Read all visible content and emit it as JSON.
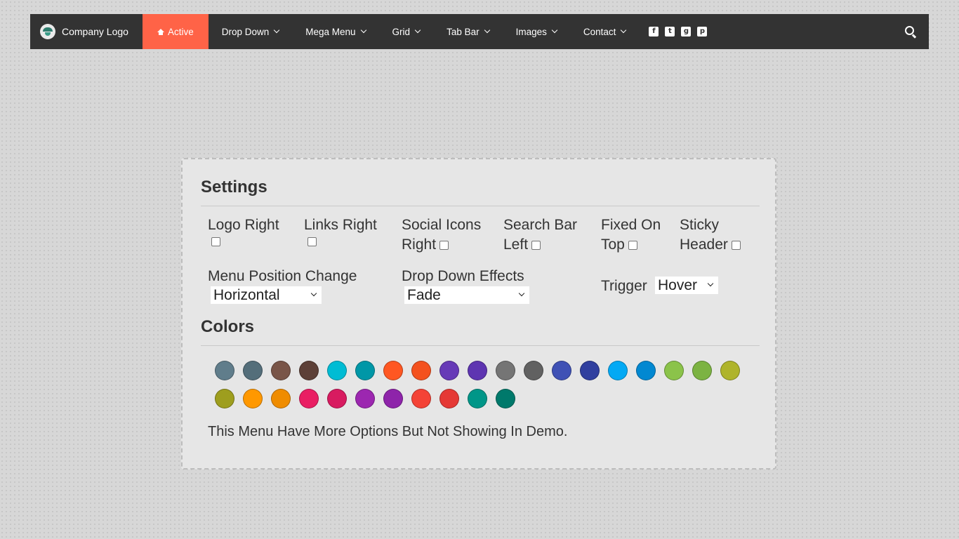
{
  "nav": {
    "brand": "Company Logo",
    "active": "Active",
    "items": [
      "Drop Down",
      "Mega Menu",
      "Grid",
      "Tab Bar",
      "Images",
      "Contact"
    ],
    "social": [
      {
        "name": "facebook-icon",
        "glyph": "f"
      },
      {
        "name": "twitter-icon",
        "glyph": "t"
      },
      {
        "name": "google-plus-icon",
        "glyph": "g"
      },
      {
        "name": "pinterest-icon",
        "glyph": "p"
      }
    ]
  },
  "settings": {
    "title": "Settings",
    "options": {
      "logo_right": "Logo Right",
      "links_right": "Links Right",
      "social_right_1": "Social Icons",
      "social_right_2": "Right",
      "search_left_1": "Search Bar",
      "search_left_2": "Left",
      "fixed_top_1": "Fixed On",
      "fixed_top_2": "Top",
      "sticky_1": "Sticky",
      "sticky_2": "Header"
    },
    "menu_position": {
      "label": "Menu Position Change",
      "value": "Horizontal"
    },
    "drop_effects": {
      "label": "Drop Down Effects",
      "value": "Fade"
    },
    "trigger": {
      "label": "Trigger",
      "value": "Hover"
    }
  },
  "colors": {
    "title": "Colors",
    "swatches": [
      "#607d8b",
      "#546e7a",
      "#795548",
      "#5d4037",
      "#00bcd4",
      "#0097a7",
      "#ff5722",
      "#f4511e",
      "#673ab7",
      "#5e35b1",
      "#757575",
      "#616161",
      "#3f51b5",
      "#303f9f",
      "#03a9f4",
      "#0288d1",
      "#8bc34a",
      "#7cb342",
      "#afb42b",
      "#9e9e1e",
      "#ff9800",
      "#ef8c00",
      "#e91e63",
      "#d81b60",
      "#9c27b0",
      "#8e24aa",
      "#f44336",
      "#e53935",
      "#009688",
      "#00796b"
    ],
    "note": "This Menu Have More Options But Not Showing In Demo."
  }
}
